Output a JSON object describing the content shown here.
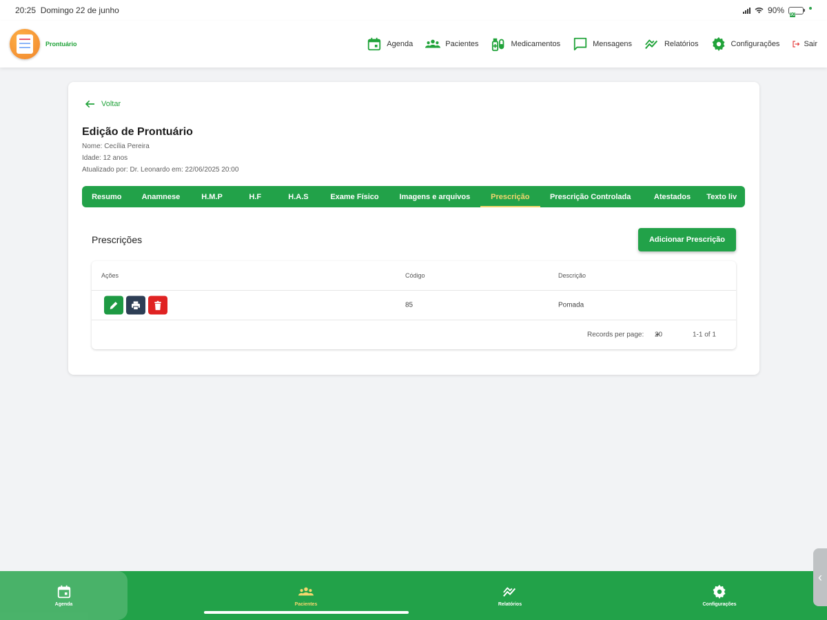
{
  "statusbar": {
    "time": "20:25",
    "date": "Domingo 22 de junho",
    "battery": "90%",
    "battery_inner": "90"
  },
  "app": {
    "logo_text": "Prontuário"
  },
  "nav": {
    "items": [
      {
        "label": "Agenda",
        "icon": "calendar-icon"
      },
      {
        "label": "Pacientes",
        "icon": "people-icon"
      },
      {
        "label": "Medicamentos",
        "icon": "medication-icon"
      },
      {
        "label": "Mensagens",
        "icon": "message-icon"
      },
      {
        "label": "Relatórios",
        "icon": "chart-icon"
      },
      {
        "label": "Configurações",
        "icon": "gear-icon"
      },
      {
        "label": "Sair",
        "icon": "logout-icon"
      }
    ]
  },
  "record": {
    "back_label": "Voltar",
    "title": "Edição de Prontuário",
    "name_line": "Nome: Cecília Pereira",
    "age_line": "Idade: 12 anos",
    "updated_line": "Atualizado por: Dr. Leonardo em: 22/06/2025 20:00"
  },
  "tabs": [
    {
      "label": "Resumo",
      "active": false
    },
    {
      "label": "Anamnese",
      "active": false
    },
    {
      "label": "H.M.P",
      "active": false
    },
    {
      "label": "H.F",
      "active": false
    },
    {
      "label": "H.A.S",
      "active": false
    },
    {
      "label": "Exame Físico",
      "active": false
    },
    {
      "label": "Imagens e arquivos",
      "active": false
    },
    {
      "label": "Prescrição",
      "active": true
    },
    {
      "label": "Prescrição Controlada",
      "active": false
    },
    {
      "label": "Atestados",
      "active": false
    },
    {
      "label": "Texto liv",
      "active": false
    }
  ],
  "prescriptions": {
    "title": "Prescrições",
    "add_label": "Adicionar Prescrição",
    "columns": [
      "Ações",
      "Código",
      "Descrição"
    ],
    "rows": [
      {
        "code": "85",
        "description": "Pomada"
      }
    ],
    "footer": {
      "records_label": "Records per page:",
      "per_page": "20",
      "range": "1-1 of 1"
    }
  },
  "bottom_nav": {
    "items": [
      {
        "label": "Agenda",
        "icon": "calendar-icon",
        "active": false
      },
      {
        "label": "Pacientes",
        "icon": "people-icon",
        "active": true
      },
      {
        "label": "Relatórios",
        "icon": "chart-icon",
        "active": false
      },
      {
        "label": "Configurações",
        "icon": "gear-icon",
        "active": false
      }
    ]
  },
  "colors": {
    "brand_green": "#22a249",
    "active_tab": "#f5d76e",
    "edit_btn": "#1e9a43",
    "print_btn": "#2d3e55",
    "delete_btn": "#e02323"
  }
}
